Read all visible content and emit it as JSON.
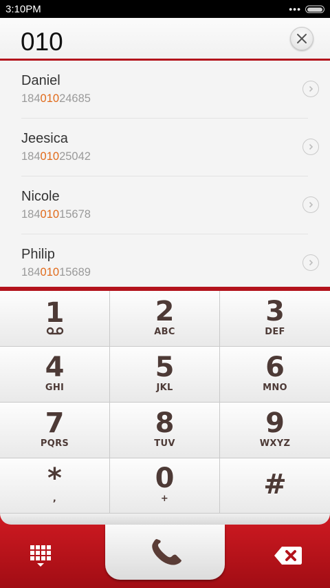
{
  "status_bar": {
    "time": "3:10PM",
    "dots": "•••"
  },
  "dial_input": {
    "value": "010"
  },
  "contacts": [
    {
      "name": "Daniel",
      "number_prefix": "184",
      "number_match": "010",
      "number_suffix": "24685"
    },
    {
      "name": "Jeesica",
      "number_prefix": "184",
      "number_match": "010",
      "number_suffix": "25042"
    },
    {
      "name": "Nicole",
      "number_prefix": "184",
      "number_match": "010",
      "number_suffix": "15678"
    },
    {
      "name": "Philip",
      "number_prefix": "184",
      "number_match": "010",
      "number_suffix": "15689"
    }
  ],
  "keypad": [
    {
      "digit": "1",
      "letters": ""
    },
    {
      "digit": "2",
      "letters": "ABC"
    },
    {
      "digit": "3",
      "letters": "DEF"
    },
    {
      "digit": "4",
      "letters": "GHI"
    },
    {
      "digit": "5",
      "letters": "JKL"
    },
    {
      "digit": "6",
      "letters": "MNO"
    },
    {
      "digit": "7",
      "letters": "PQRS"
    },
    {
      "digit": "8",
      "letters": "TUV"
    },
    {
      "digit": "9",
      "letters": "WXYZ"
    },
    {
      "digit": "*",
      "letters": ","
    },
    {
      "digit": "0",
      "letters": "+"
    },
    {
      "digit": "#",
      "letters": ""
    }
  ],
  "icons": {
    "clear": "close-icon",
    "contact_detail": "chevron-right-icon",
    "voicemail": "voicemail-icon",
    "dialpad": "dialpad-icon",
    "call": "phone-icon",
    "backspace": "backspace-icon"
  },
  "colors": {
    "accent_red": "#b3131c",
    "match_highlight": "#e06a1a",
    "key_text": "#4d3a36"
  }
}
